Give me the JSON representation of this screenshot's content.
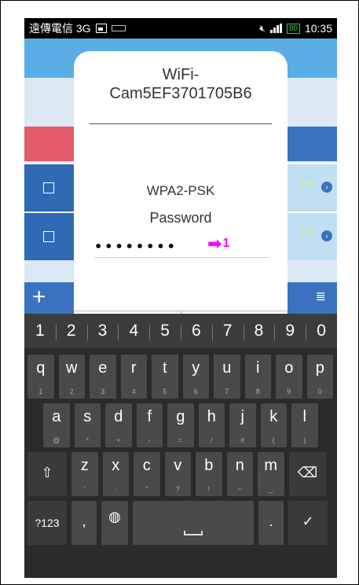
{
  "status_bar": {
    "carrier": "遠傳電信 3G",
    "battery": "80",
    "time": "10:35"
  },
  "dialog": {
    "ssid": "WiFi-\nCam5EF3701705B6",
    "security": "WPA2-PSK",
    "password_label": "Password",
    "password_value": "••••••••"
  },
  "annotation": {
    "label": "1",
    "color": "#ff00ff"
  },
  "keyboard": {
    "number_row": [
      "1",
      "2",
      "3",
      "4",
      "5",
      "6",
      "7",
      "8",
      "9",
      "0"
    ],
    "row1": [
      {
        "m": "q",
        "s": "1"
      },
      {
        "m": "w",
        "s": "2"
      },
      {
        "m": "e",
        "s": "3"
      },
      {
        "m": "r",
        "s": "4"
      },
      {
        "m": "t",
        "s": "5"
      },
      {
        "m": "y",
        "s": "6"
      },
      {
        "m": "u",
        "s": "7"
      },
      {
        "m": "i",
        "s": "8"
      },
      {
        "m": "o",
        "s": "9"
      },
      {
        "m": "p",
        "s": "0"
      }
    ],
    "row2": [
      {
        "m": "a",
        "s": "@"
      },
      {
        "m": "s",
        "s": "*"
      },
      {
        "m": "d",
        "s": "+"
      },
      {
        "m": "f",
        "s": "-"
      },
      {
        "m": "g",
        "s": "="
      },
      {
        "m": "h",
        "s": "/"
      },
      {
        "m": "j",
        "s": "#"
      },
      {
        "m": "k",
        "s": "("
      },
      {
        "m": "l",
        "s": ")"
      }
    ],
    "row3": [
      {
        "m": "z",
        "s": "'"
      },
      {
        "m": "x",
        "s": ":"
      },
      {
        "m": "c",
        "s": "\""
      },
      {
        "m": "v",
        "s": "?"
      },
      {
        "m": "b",
        "s": "!"
      },
      {
        "m": "n",
        "s": "~"
      },
      {
        "m": "m",
        "s": "_"
      }
    ],
    "symbols_label": "?123",
    "comma": ",",
    "period": "."
  },
  "icons": {
    "wifi": "wifi-icon",
    "shift": "shift-icon",
    "backspace": "backspace-icon",
    "globe": "globe-icon",
    "enter": "check-icon"
  },
  "colors": {
    "app_blue": "#3a72c0",
    "app_red": "#e35a6a",
    "keyboard_bg": "#2b2b2b"
  }
}
